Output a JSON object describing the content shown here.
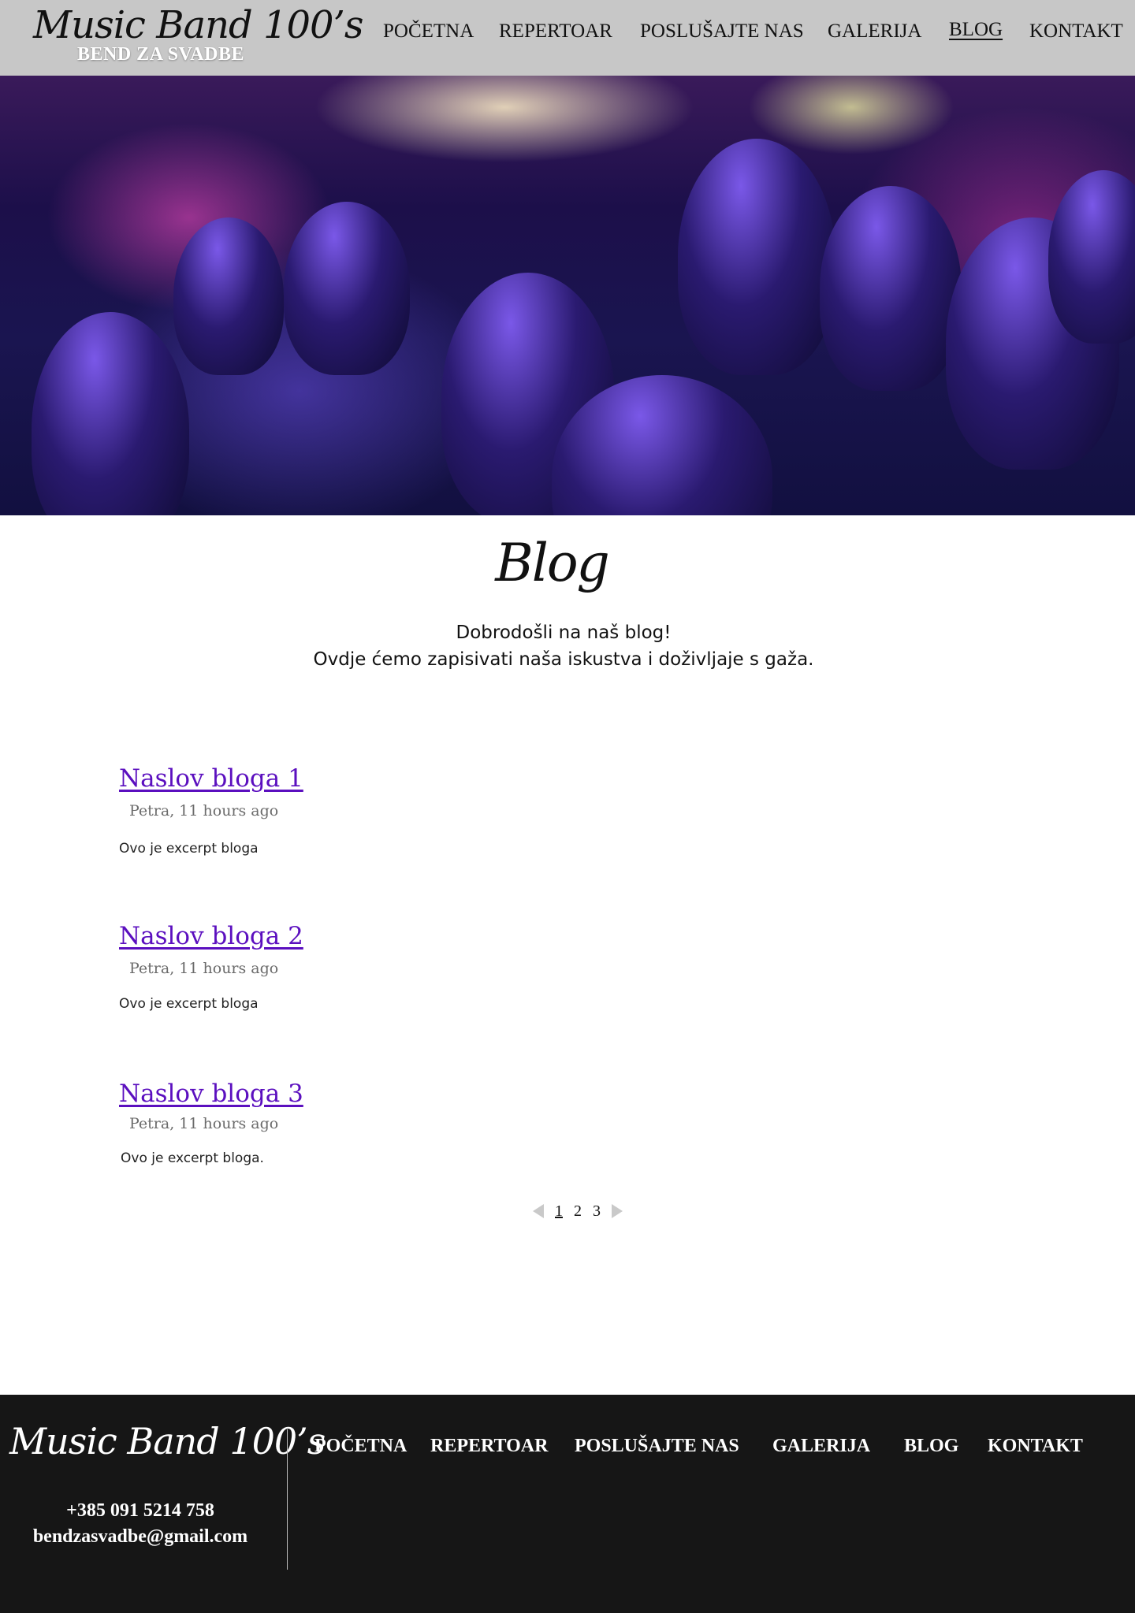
{
  "header": {
    "logo_script": "Music Band 100’s",
    "logo_subtitle": "BEND ZA SVADBE",
    "nav": [
      "POČETNA",
      "REPERTOAR",
      "POSLUŠAJTE NAS",
      "GALERIJA",
      "BLOG",
      "KONTAKT"
    ],
    "active_nav": "BLOG"
  },
  "hero": {
    "image": "concert-crowd-image"
  },
  "page": {
    "title": "Blog",
    "intro_line1": "Dobrodošli na naš blog!",
    "intro_line2": "Ovdje ćemo zapisivati naša iskustva i doživljaje s gaža."
  },
  "posts": [
    {
      "title": "Naslov bloga 1",
      "meta": "Petra, 11 hours ago",
      "excerpt": "Ovo je excerpt bloga"
    },
    {
      "title": "Naslov bloga 2",
      "meta": "Petra, 11 hours ago",
      "excerpt": "Ovo je excerpt bloga"
    },
    {
      "title": "Naslov bloga 3",
      "meta": "Petra, 11 hours ago",
      "excerpt": "Ovo je excerpt bloga."
    }
  ],
  "pagination": {
    "pages": [
      "1",
      "2",
      "3"
    ],
    "current": "1"
  },
  "footer": {
    "logo_script": "Music Band 100’s",
    "phone": "+385 091 5214 758",
    "email": "bendzasvadbe@gmail.com",
    "nav": [
      "POČETNA",
      "REPERTOAR",
      "POSLUŠAJTE NAS",
      "GALERIJA",
      "BLOG",
      "KONTAKT"
    ]
  },
  "colors": {
    "header_bg": "#c7c7c7",
    "post_link": "#5b0fbf",
    "footer_bg": "#161616"
  }
}
